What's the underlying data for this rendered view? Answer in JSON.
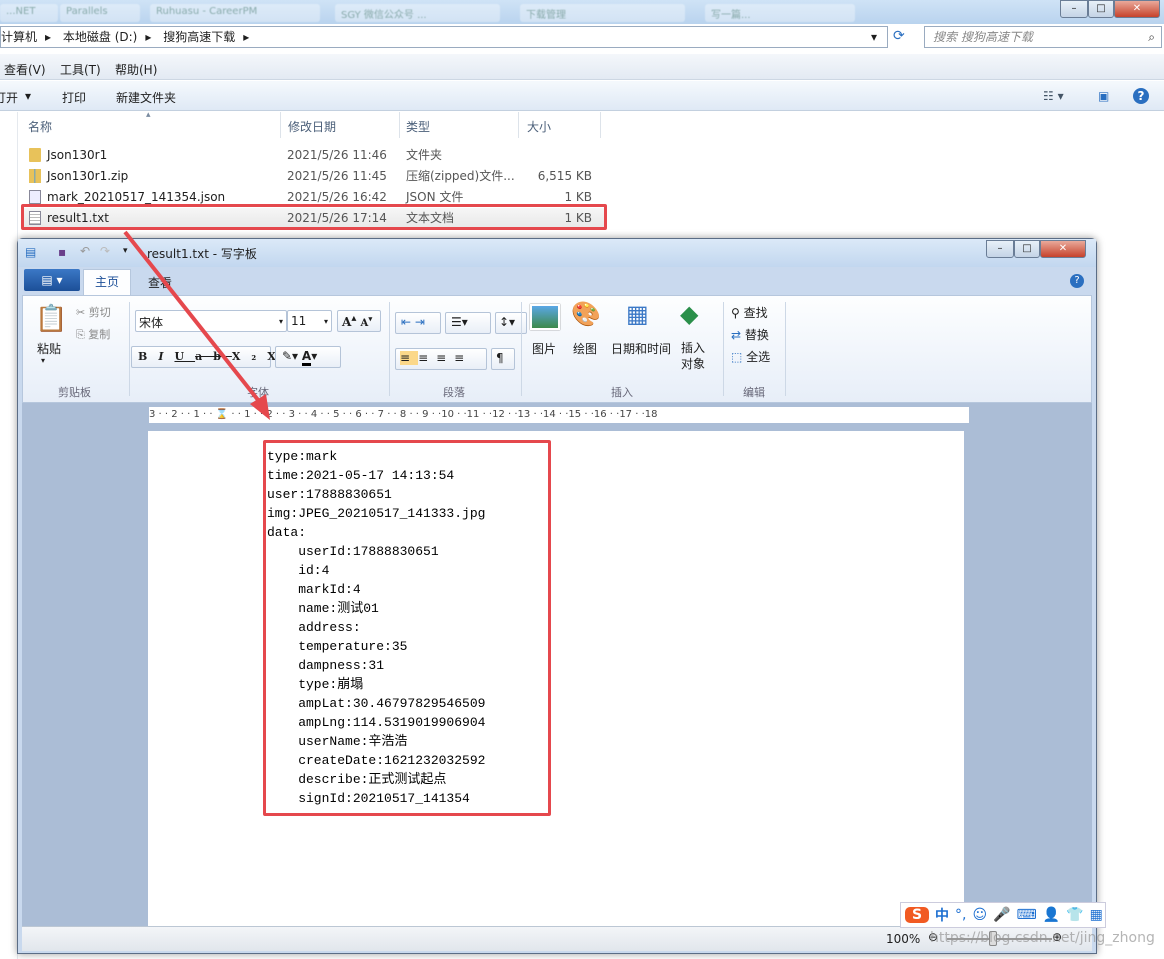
{
  "explorer": {
    "browser_tabs": [
      "...NET",
      "Parallels",
      "Ruhuasu - CareerPM",
      "SGY 微信公众号 ...",
      "下载管理",
      "写一篇..."
    ],
    "breadcrumb": [
      "计算机",
      "本地磁盘 (D:)",
      "搜狗高速下载"
    ],
    "search_placeholder": "搜索 搜狗高速下载",
    "menu": [
      "查看(V)",
      "工具(T)",
      "帮助(H)"
    ],
    "toolbar": [
      "打开",
      "打印",
      "新建文件夹"
    ],
    "columns": [
      "名称",
      "修改日期",
      "类型",
      "大小"
    ],
    "files": [
      {
        "name": "Json130r1",
        "date": "2021/5/26 11:46",
        "type": "文件夹",
        "size": "",
        "icon": "folder-icon"
      },
      {
        "name": "Json130r1.zip",
        "date": "2021/5/26 11:45",
        "type": "压缩(zipped)文件...",
        "size": "6,515 KB",
        "icon": "zip-icon"
      },
      {
        "name": "mark_20210517_141354.json",
        "date": "2021/5/26 16:42",
        "type": "JSON 文件",
        "size": "1 KB",
        "icon": "json-file-icon"
      },
      {
        "name": "result1.txt",
        "date": "2021/5/26 17:14",
        "type": "文本文档",
        "size": "1 KB",
        "icon": "text-file-icon",
        "highlighted": true
      }
    ]
  },
  "wordpad": {
    "title": "result1.txt - 写字板",
    "tabs": [
      "主页",
      "查看"
    ],
    "clipboard": {
      "paste": "粘贴",
      "cut": "剪切",
      "copy": "复制",
      "group": "剪贴板"
    },
    "font": {
      "name": "宋体",
      "size": "11",
      "group": "字体"
    },
    "paragraph": {
      "group": "段落"
    },
    "insert": {
      "picture": "图片",
      "paint": "绘图",
      "datetime": "日期和时间",
      "object": "插入对象",
      "group": "插入"
    },
    "edit": {
      "find": "查找",
      "replace": "替换",
      "selectall": "全选",
      "group": "编辑"
    },
    "ruler": "3 · · 2 · · 1 · · ⌛ · · 1 · · 2 · · 3 · · 4 · · 5 · · 6 · · 7 · · 8 · · 9 · ·10 · ·11 · ·12 · ·13 · ·14 · ·15 · ·16 · ·17 · ·18",
    "content": [
      "type:mark",
      "time:2021-05-17 14:13:54",
      "user:17888830651",
      "img:JPEG_20210517_141333.jpg",
      "data:",
      "    userId:17888830651",
      "    id:4",
      "    markId:4",
      "    name:测试01",
      "    address:",
      "    temperature:35",
      "    dampness:31",
      "    type:崩塌",
      "    ampLat:30.46797829546509",
      "    ampLng:114.5319019906904",
      "    userName:辛浩浩",
      "    createDate:1621232032592",
      "    describe:正式测试起点",
      "    signId:20210517_141354"
    ],
    "zoom": "100%"
  },
  "ime": {
    "label": "中",
    "punct": "°,"
  },
  "watermark": "https://blog.csdn.net/jing_zhong",
  "colors": {
    "highlight": "#e5484d",
    "accent": "#1d6fd1"
  }
}
